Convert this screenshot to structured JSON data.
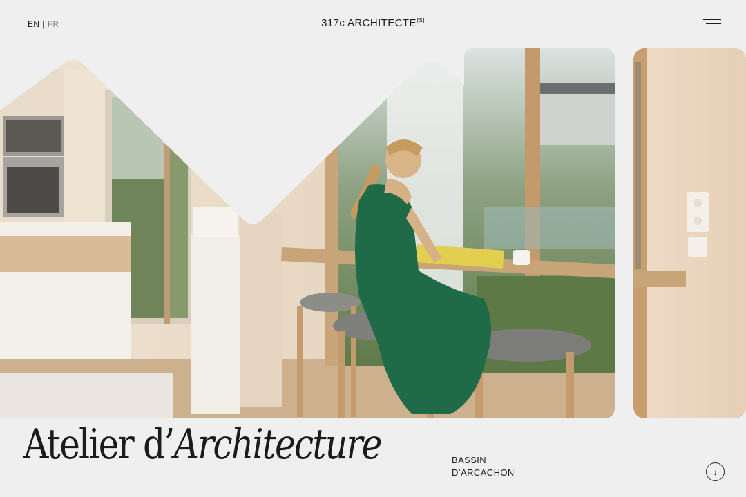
{
  "header": {
    "languages": [
      {
        "code": "EN",
        "active": true
      },
      {
        "code": "FR",
        "active": false
      }
    ],
    "separator": "|",
    "brand_name": "317c ARCHITECTE",
    "brand_suffix": "[S]",
    "menu_icon": "hamburger-menu-icon"
  },
  "hero": {
    "image_subject": "woman-reading-at-kitchen-counter",
    "colors": {
      "background": "#efefef",
      "dress": "#1f6b48",
      "wood": "#c7a47c",
      "wall": "#e6d6c2",
      "greenery": "#4f6a3c"
    }
  },
  "headline": {
    "plain": "Atelier d’",
    "italic": "Architecture"
  },
  "location": {
    "line1": "BASSIN",
    "line2": "D’ARCACHON"
  },
  "scroll": {
    "icon": "arrow-down-icon",
    "glyph": "↓"
  }
}
